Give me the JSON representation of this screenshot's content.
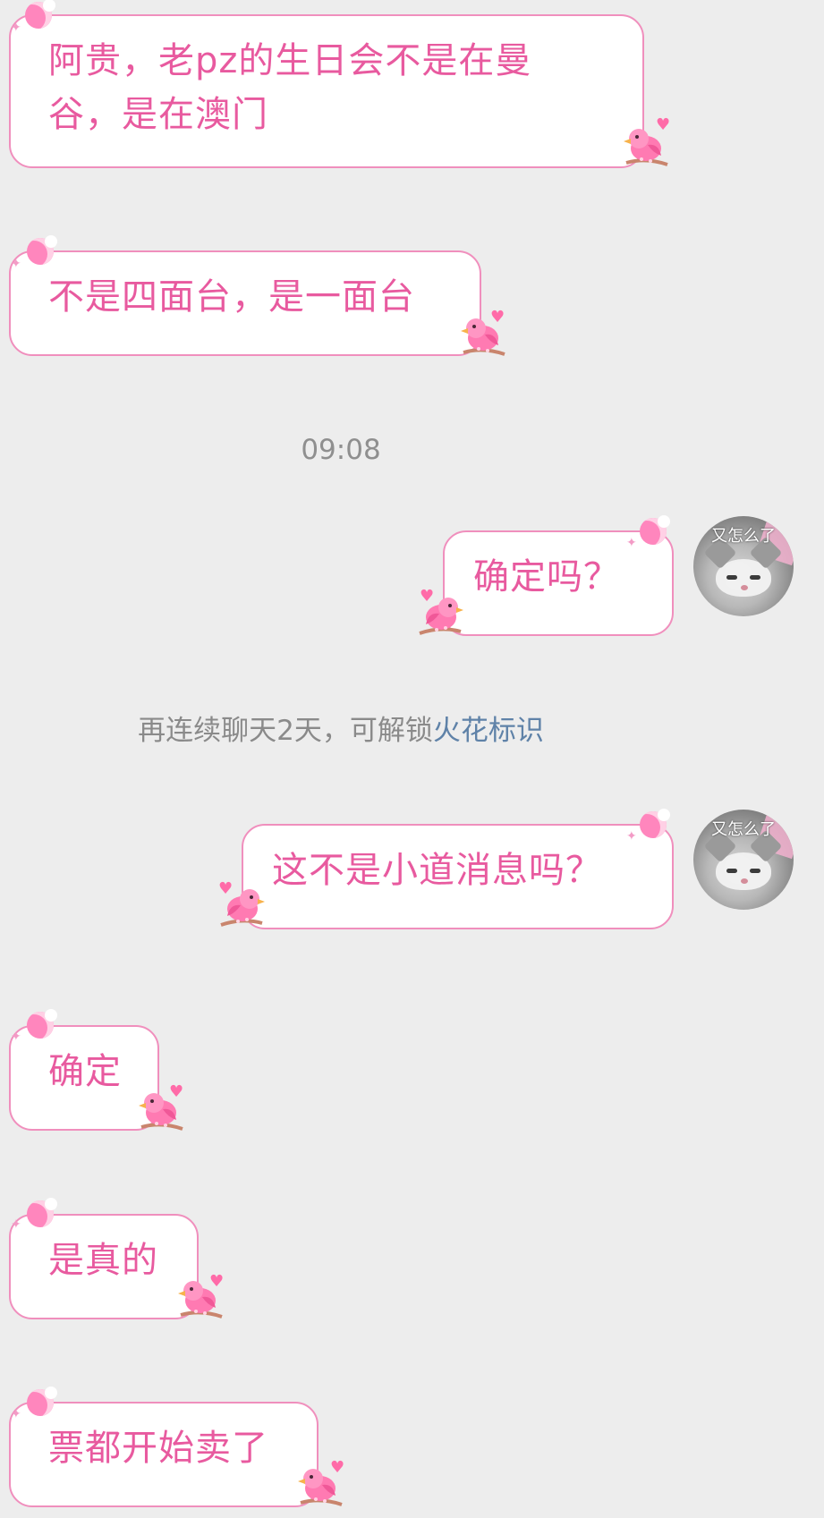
{
  "conversation": {
    "messages": [
      {
        "id": "m1",
        "side": "left",
        "lines": [
          "阿贵，老pz的生日会不是在曼",
          "谷，是在澳门"
        ]
      },
      {
        "id": "m2",
        "side": "left",
        "lines": [
          "不是四面台，是一面台"
        ]
      },
      {
        "id": "m3",
        "side": "right",
        "lines": [
          "确定吗？"
        ]
      },
      {
        "id": "m4",
        "side": "right",
        "lines": [
          "这不是小道消息吗？"
        ]
      },
      {
        "id": "m5",
        "side": "left",
        "lines": [
          "确定"
        ]
      },
      {
        "id": "m6",
        "side": "left",
        "lines": [
          "是真的"
        ]
      },
      {
        "id": "m7",
        "side": "left",
        "lines": [
          "票都开始卖了"
        ]
      }
    ],
    "timestamp": "09:08",
    "notice": {
      "prefix": "再连续聊天2天，可解锁",
      "link": "火花标识"
    },
    "avatar": {
      "caption": "又怎么了"
    }
  },
  "colors": {
    "background": "#ededed",
    "bubble_border": "#f08fbd",
    "bubble_text": "#e85a9f",
    "link": "#5f82a8",
    "muted": "#8f8f8f"
  },
  "icons": [
    "moon-icon",
    "sparkle-icon",
    "bird-icon",
    "heart-icon",
    "cat-avatar"
  ]
}
